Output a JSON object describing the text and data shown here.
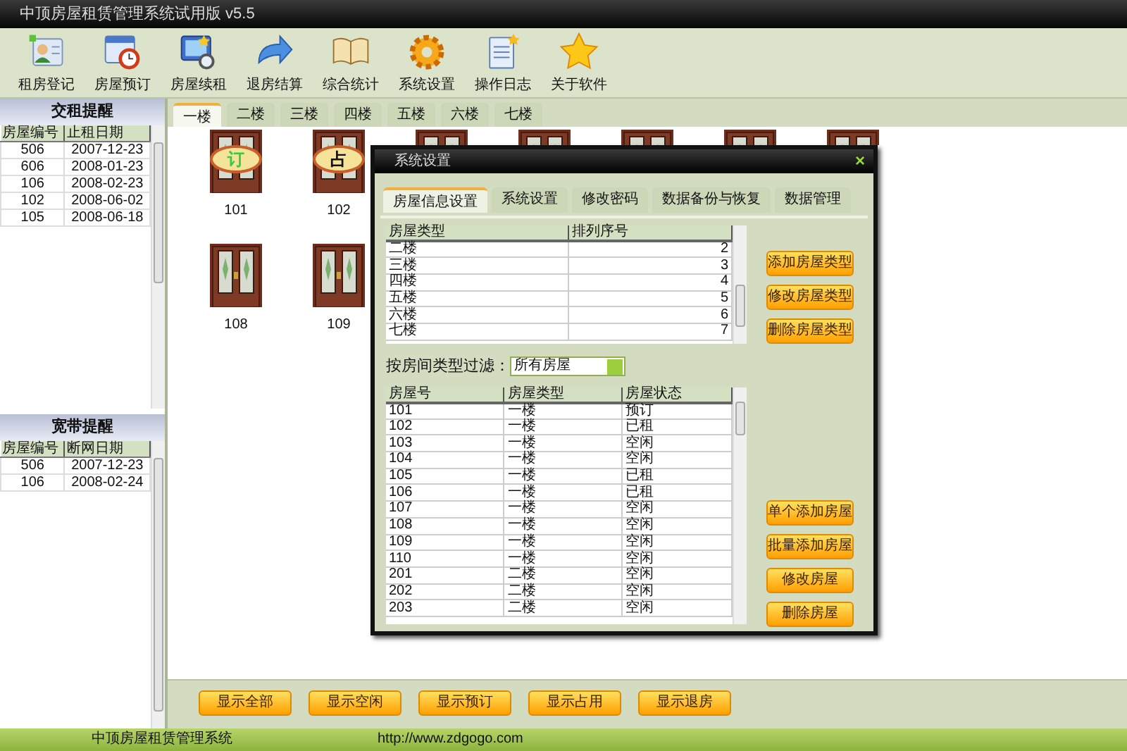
{
  "window": {
    "title": "中顶房屋租赁管理系统试用版 v5.5"
  },
  "toolbar": [
    {
      "label": "租房登记"
    },
    {
      "label": "房屋预订"
    },
    {
      "label": "房屋续租"
    },
    {
      "label": "退房结算"
    },
    {
      "label": "综合统计"
    },
    {
      "label": "系统设置"
    },
    {
      "label": "操作日志"
    },
    {
      "label": "关于软件"
    }
  ],
  "rent_reminder": {
    "title": "交租提醒",
    "columns": [
      "房屋编号",
      "止租日期"
    ],
    "rows": [
      [
        "506",
        "2007-12-23"
      ],
      [
        "606",
        "2008-01-23"
      ],
      [
        "106",
        "2008-02-23"
      ],
      [
        "102",
        "2008-06-02"
      ],
      [
        "105",
        "2008-06-18"
      ]
    ]
  },
  "broadband_reminder": {
    "title": "宽带提醒",
    "columns": [
      "房屋编号",
      "断网日期"
    ],
    "rows": [
      [
        "506",
        "2007-12-23"
      ],
      [
        "106",
        "2008-02-24"
      ]
    ]
  },
  "floor_tabs": [
    {
      "label": "一楼",
      "selected": true
    },
    {
      "label": "二楼",
      "selected": false
    },
    {
      "label": "三楼",
      "selected": false
    },
    {
      "label": "四楼",
      "selected": false
    },
    {
      "label": "五楼",
      "selected": false
    },
    {
      "label": "六楼",
      "selected": false
    },
    {
      "label": "七楼",
      "selected": false
    }
  ],
  "rooms": [
    {
      "kind": "door",
      "number": "101",
      "sign": "订"
    },
    {
      "kind": "door",
      "number": "102",
      "sign": "占"
    },
    {
      "kind": "partial"
    },
    {
      "kind": "partial"
    },
    {
      "kind": "partial"
    },
    {
      "kind": "partial"
    },
    {
      "kind": "partial"
    },
    {
      "kind": "door",
      "number": "108"
    },
    {
      "kind": "door",
      "number": "109"
    }
  ],
  "filter_buttons": [
    "显示全部",
    "显示空闲",
    "显示预订",
    "显示占用",
    "显示退房"
  ],
  "status_bar": {
    "name": "中顶房屋租赁管理系统",
    "url": "http://www.zdgogo.com"
  },
  "dialog": {
    "title": "系统设置",
    "close": "×",
    "tabs": [
      {
        "label": "房屋信息设置",
        "selected": true
      },
      {
        "label": "系统设置",
        "selected": false
      },
      {
        "label": "修改密码",
        "selected": false
      },
      {
        "label": "数据备份与恢复",
        "selected": false
      },
      {
        "label": "数据管理",
        "selected": false
      }
    ],
    "type_table": {
      "columns": [
        "房屋类型",
        "排列序号"
      ],
      "rows": [
        [
          "二楼",
          "2"
        ],
        [
          "三楼",
          "3"
        ],
        [
          "四楼",
          "4"
        ],
        [
          "五楼",
          "5"
        ],
        [
          "六楼",
          "6"
        ],
        [
          "七楼",
          "7"
        ]
      ]
    },
    "type_buttons": [
      "添加房屋类型",
      "修改房屋类型",
      "删除房屋类型"
    ],
    "filter": {
      "label": "按房间类型过滤：",
      "value": "所有房屋"
    },
    "room_table": {
      "columns": [
        "房屋号",
        "房屋类型",
        "房屋状态"
      ],
      "rows": [
        [
          "101",
          "一楼",
          "预订"
        ],
        [
          "102",
          "一楼",
          "已租"
        ],
        [
          "103",
          "一楼",
          "空闲"
        ],
        [
          "104",
          "一楼",
          "空闲"
        ],
        [
          "105",
          "一楼",
          "已租"
        ],
        [
          "106",
          "一楼",
          "已租"
        ],
        [
          "107",
          "一楼",
          "空闲"
        ],
        [
          "108",
          "一楼",
          "空闲"
        ],
        [
          "109",
          "一楼",
          "空闲"
        ],
        [
          "110",
          "一楼",
          "空闲"
        ],
        [
          "201",
          "二楼",
          "空闲"
        ],
        [
          "202",
          "二楼",
          "空闲"
        ],
        [
          "203",
          "二楼",
          "空闲"
        ]
      ]
    },
    "room_buttons": [
      "单个添加房屋",
      "批量添加房屋",
      "修改房屋",
      "删除房屋"
    ]
  }
}
